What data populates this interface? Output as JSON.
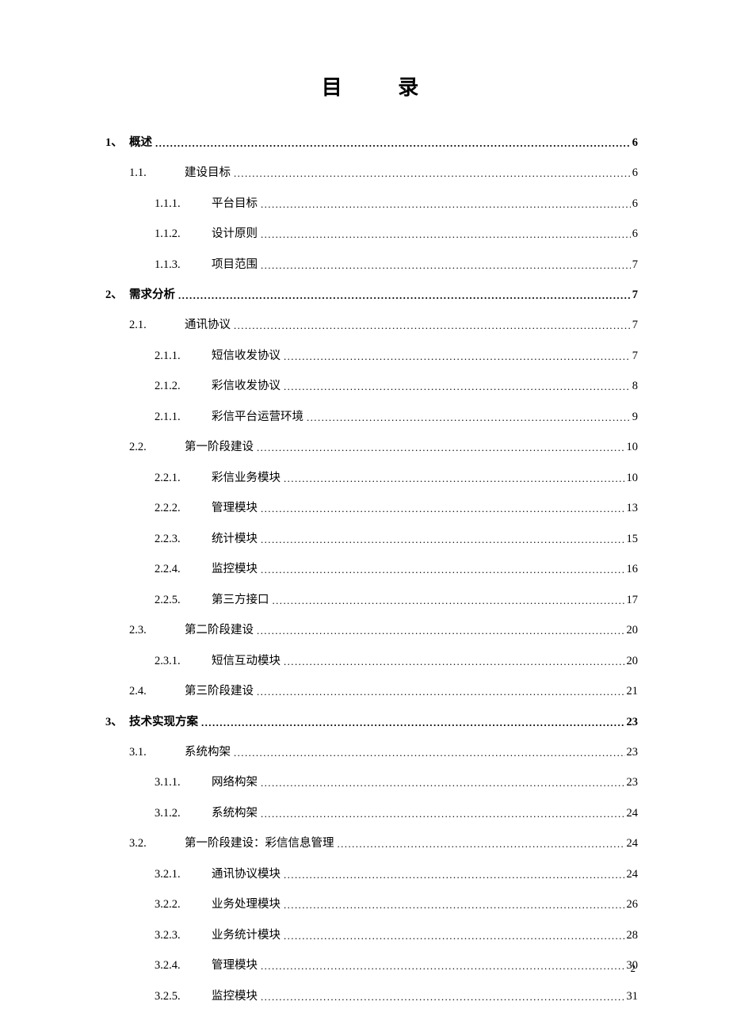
{
  "title": "目 录",
  "page_number": "2",
  "entries": [
    {
      "level": 1,
      "num": "1、",
      "text": "概述",
      "page": "6"
    },
    {
      "level": 2,
      "num": "1.1.",
      "text": "建设目标",
      "page": "6"
    },
    {
      "level": 3,
      "num": "1.1.1.",
      "text": "平台目标",
      "page": "6"
    },
    {
      "level": 3,
      "num": "1.1.2.",
      "text": "设计原则",
      "page": "6"
    },
    {
      "level": 3,
      "num": "1.1.3.",
      "text": "项目范围",
      "page": "7"
    },
    {
      "level": 1,
      "num": "2、",
      "text": "需求分析",
      "page": "7"
    },
    {
      "level": 2,
      "num": "2.1.",
      "text": "通讯协议",
      "page": "7"
    },
    {
      "level": 3,
      "num": "2.1.1.",
      "text": "短信收发协议",
      "page": "7"
    },
    {
      "level": 3,
      "num": "2.1.2.",
      "text": "彩信收发协议",
      "page": "8"
    },
    {
      "level": 3,
      "num": "2.1.1.",
      "text": "彩信平台运营环境",
      "page": "9"
    },
    {
      "level": 2,
      "num": "2.2.",
      "text": "第一阶段建设",
      "page": "10"
    },
    {
      "level": 3,
      "num": "2.2.1.",
      "text": "彩信业务模块",
      "page": "10"
    },
    {
      "level": 3,
      "num": "2.2.2.",
      "text": "管理模块",
      "page": "13"
    },
    {
      "level": 3,
      "num": "2.2.3.",
      "text": "统计模块",
      "page": "15"
    },
    {
      "level": 3,
      "num": "2.2.4.",
      "text": "监控模块",
      "page": "16"
    },
    {
      "level": 3,
      "num": "2.2.5.",
      "text": "第三方接口",
      "page": "17"
    },
    {
      "level": 2,
      "num": "2.3.",
      "text": "第二阶段建设",
      "page": "20"
    },
    {
      "level": 3,
      "num": "2.3.1.",
      "text": "短信互动模块",
      "page": "20"
    },
    {
      "level": 2,
      "num": "2.4.",
      "text": "第三阶段建设",
      "page": "21"
    },
    {
      "level": 1,
      "num": "3、",
      "text": "技术实现方案",
      "page": "23"
    },
    {
      "level": 2,
      "num": "3.1.",
      "text": "系统构架",
      "page": "23"
    },
    {
      "level": 3,
      "num": "3.1.1.",
      "text": "网络构架",
      "page": "23"
    },
    {
      "level": 3,
      "num": "3.1.2.",
      "text": "系统构架",
      "page": "24"
    },
    {
      "level": 2,
      "num": "3.2.",
      "text": "第一阶段建设：彩信信息管理",
      "page": "24"
    },
    {
      "level": 3,
      "num": "3.2.1.",
      "text": "通讯协议模块",
      "page": "24"
    },
    {
      "level": 3,
      "num": "3.2.2.",
      "text": "业务处理模块",
      "page": "26"
    },
    {
      "level": 3,
      "num": "3.2.3.",
      "text": "业务统计模块",
      "page": "28"
    },
    {
      "level": 3,
      "num": "3.2.4.",
      "text": "管理模块",
      "page": "30"
    },
    {
      "level": 3,
      "num": "3.2.5.",
      "text": "监控模块",
      "page": "31"
    }
  ]
}
